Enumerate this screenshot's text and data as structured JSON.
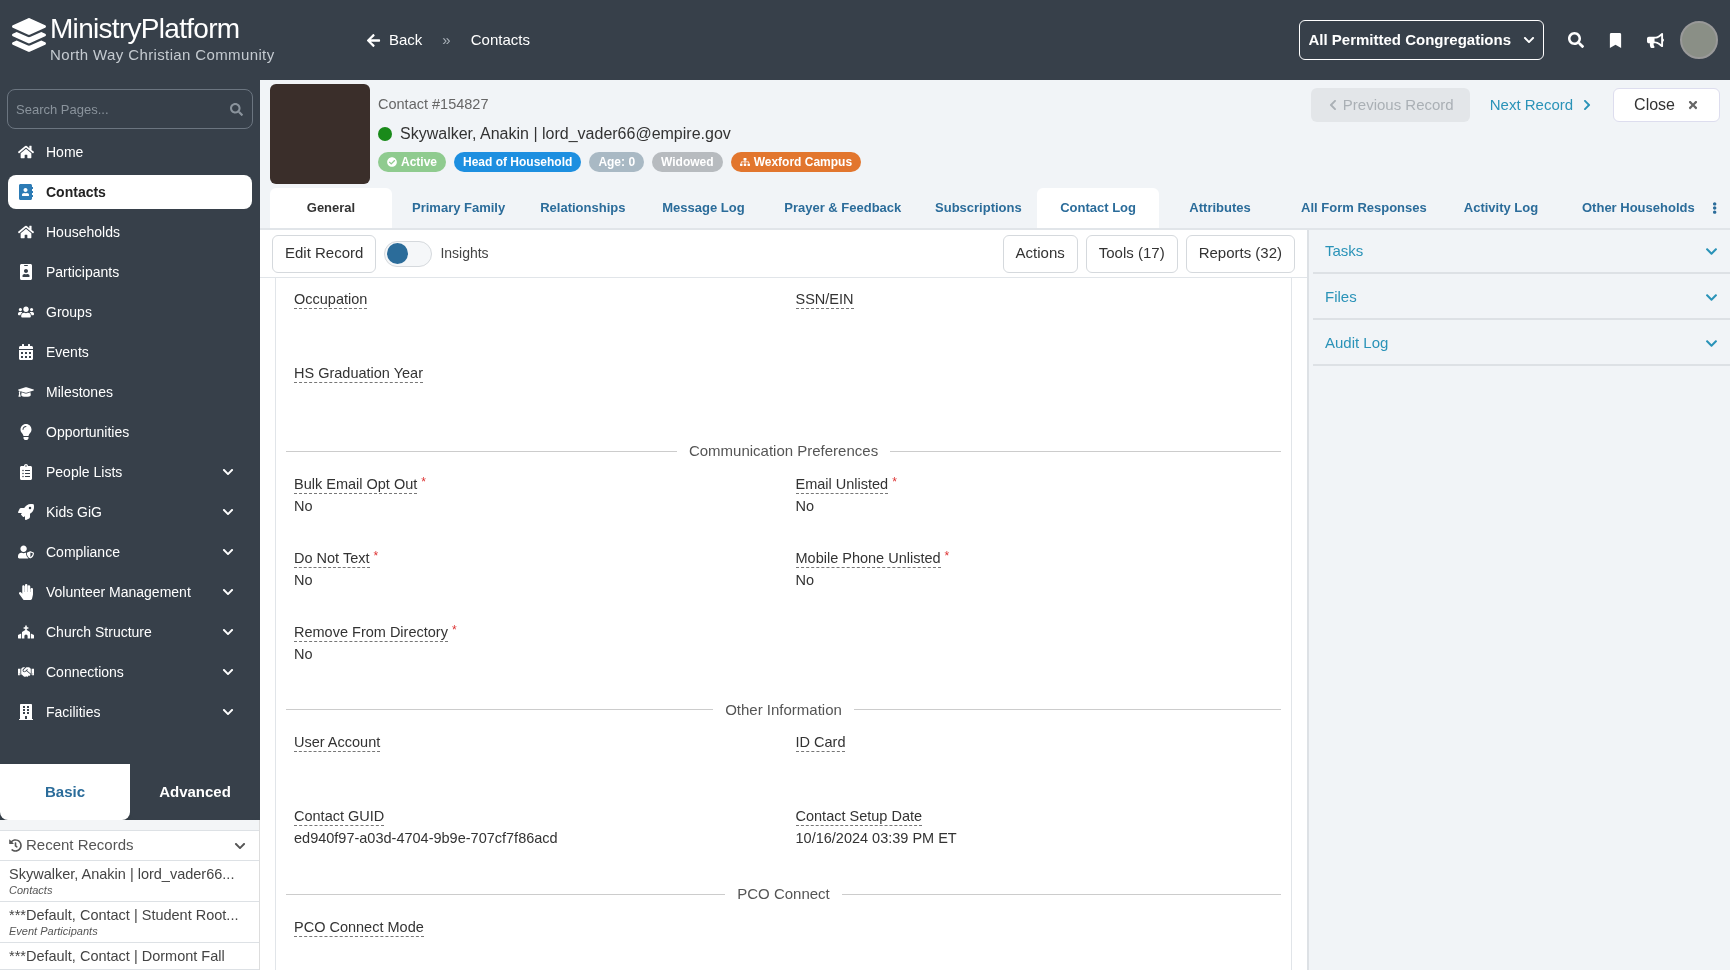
{
  "brand": {
    "name": "MinistryPlatform",
    "organization": "North Way Christian Community"
  },
  "breadcrumb": {
    "back": "Back",
    "separator": "»",
    "current": "Contacts"
  },
  "topbar": {
    "congregation": "All Permitted Congregations"
  },
  "sidebar": {
    "search": {
      "placeholder": "Search Pages..."
    },
    "items": [
      {
        "label": "Home",
        "selected": false,
        "expandable": false
      },
      {
        "label": "Contacts",
        "selected": true,
        "expandable": false
      },
      {
        "label": "Households",
        "selected": false,
        "expandable": false
      },
      {
        "label": "Participants",
        "selected": false,
        "expandable": false
      },
      {
        "label": "Groups",
        "selected": false,
        "expandable": false
      },
      {
        "label": "Events",
        "selected": false,
        "expandable": false
      },
      {
        "label": "Milestones",
        "selected": false,
        "expandable": false
      },
      {
        "label": "Opportunities",
        "selected": false,
        "expandable": false
      },
      {
        "label": "People Lists",
        "selected": false,
        "expandable": true
      },
      {
        "label": "Kids GiG",
        "selected": false,
        "expandable": true
      },
      {
        "label": "Compliance",
        "selected": false,
        "expandable": true
      },
      {
        "label": "Volunteer Management",
        "selected": false,
        "expandable": true
      },
      {
        "label": "Church Structure",
        "selected": false,
        "expandable": true
      },
      {
        "label": "Connections",
        "selected": false,
        "expandable": true
      },
      {
        "label": "Facilities",
        "selected": false,
        "expandable": true
      }
    ],
    "modes": [
      {
        "label": "Basic",
        "selected": true
      },
      {
        "label": "Advanced",
        "selected": false
      }
    ],
    "recent": {
      "title": "Recent Records",
      "items": [
        {
          "title": "Skywalker, Anakin | lord_vader66...",
          "subtitle": "Contacts"
        },
        {
          "title": "***Default, Contact | Student Root...",
          "subtitle": "Event Participants"
        },
        {
          "title": "***Default, Contact | Dormont Fall"
        }
      ]
    }
  },
  "record": {
    "number": "Contact #154827",
    "name": "Skywalker, Anakin | lord_vader66@empire.gov",
    "active": true,
    "tags": [
      {
        "label": "Active",
        "color": "#8fcb8f",
        "kind": "check"
      },
      {
        "label": "Head of Household",
        "color": "#1d8fe0",
        "kind": "plain"
      },
      {
        "label": "Age: 0",
        "color": "#a9b9c4",
        "kind": "plain"
      },
      {
        "label": "Widowed",
        "color": "#b7bbbf",
        "kind": "plain"
      },
      {
        "label": "Wexford Campus",
        "color": "#e2762e",
        "kind": "campus"
      }
    ],
    "previous": {
      "label": "Previous Record",
      "disabled": true
    },
    "next": {
      "label": "Next Record"
    },
    "close": "Close"
  },
  "tabs": [
    {
      "label": "General",
      "selected": true,
      "highlighted": false
    },
    {
      "label": "Primary Family",
      "selected": false,
      "highlighted": false
    },
    {
      "label": "Relationships",
      "selected": false,
      "highlighted": false
    },
    {
      "label": "Message Log",
      "selected": false,
      "highlighted": false
    },
    {
      "label": "Prayer & Feedback",
      "selected": false,
      "highlighted": false
    },
    {
      "label": "Subscriptions",
      "selected": false,
      "highlighted": false
    },
    {
      "label": "Contact Log",
      "selected": false,
      "highlighted": true
    },
    {
      "label": "Attributes",
      "selected": false,
      "highlighted": false
    },
    {
      "label": "All Form Responses",
      "selected": false,
      "highlighted": false
    },
    {
      "label": "Activity Log",
      "selected": false,
      "highlighted": false
    },
    {
      "label": "Other Households",
      "selected": false,
      "highlighted": false
    }
  ],
  "toolbar": {
    "edit": "Edit Record",
    "insights": {
      "label": "Insights",
      "on": false
    },
    "buttons": [
      "Actions",
      "Tools (17)",
      "Reports (32)"
    ]
  },
  "form": {
    "sections": [
      {
        "fields": [
          {
            "label": "Occupation"
          },
          {
            "label": "SSN/EIN"
          },
          {
            "label": "HS Graduation Year"
          }
        ]
      },
      {
        "title": "Communication Preferences",
        "fields": [
          {
            "label": "Bulk Email Opt Out",
            "marker": "*",
            "value": "No"
          },
          {
            "label": "Email Unlisted",
            "marker": "*",
            "value": "No"
          },
          {
            "label": "Do Not Text",
            "marker": "*",
            "value": "No"
          },
          {
            "label": "Mobile Phone Unlisted",
            "marker": "*",
            "value": "No"
          },
          {
            "label": "Remove From Directory",
            "marker": "*",
            "value": "No"
          }
        ]
      },
      {
        "title": "Other Information",
        "fields": [
          {
            "label": "User Account"
          },
          {
            "label": "ID Card"
          },
          {
            "label": "Contact GUID",
            "value": "ed940f97-a03d-4704-9b9e-707cf7f86acd"
          },
          {
            "label": "Contact Setup Date",
            "value": "10/16/2024 03:39 PM ET"
          }
        ]
      },
      {
        "title": "PCO Connect",
        "fields": [
          {
            "label": "PCO Connect Mode"
          }
        ]
      }
    ]
  },
  "panels": [
    {
      "title": "Tasks"
    },
    {
      "title": "Files"
    },
    {
      "title": "Audit Log"
    }
  ]
}
